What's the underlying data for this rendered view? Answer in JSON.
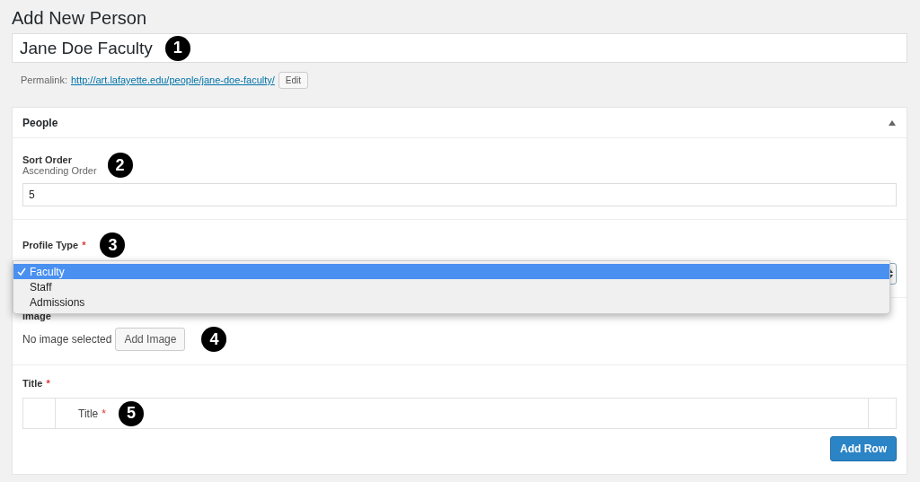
{
  "page_title": "Add New Person",
  "title_field": {
    "value": "Jane Doe Faculty",
    "callout": "1"
  },
  "permalink": {
    "label": "Permalink:",
    "url": "http://art.lafayette.edu/people/jane-doe-faculty/",
    "button": "Edit"
  },
  "panel": {
    "title": "People",
    "expanded": true,
    "sort_order": {
      "label": "Sort Order",
      "description": "Ascending Order",
      "value": "5",
      "callout": "2"
    },
    "profile_type": {
      "label": "Profile Type",
      "required_mark": "*",
      "callout": "3",
      "open": true,
      "options": [
        {
          "label": "Faculty",
          "selected": true
        },
        {
          "label": "Staff",
          "selected": false
        },
        {
          "label": "Admissions",
          "selected": false
        }
      ]
    },
    "image": {
      "label": "Image",
      "status": "No image selected",
      "button": "Add Image",
      "callout": "4"
    },
    "title_repeater": {
      "label": "Title",
      "required_mark": "*",
      "column": "Title",
      "column_required_mark": "*",
      "callout": "5",
      "button": "Add Row"
    }
  }
}
